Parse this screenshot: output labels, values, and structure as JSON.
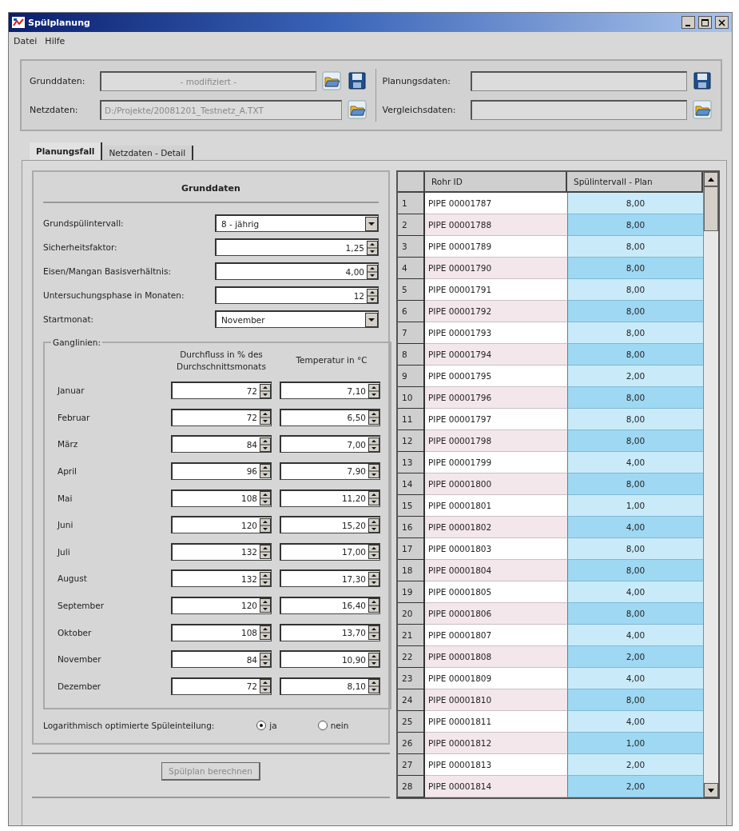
{
  "window": {
    "title": "Spülplanung"
  },
  "menu": [
    "Datei",
    "Hilfe"
  ],
  "files": {
    "left": [
      {
        "label": "Grunddaten:",
        "value": "- modifiziert -",
        "actions": [
          {
            "kind": "open"
          },
          {
            "kind": "save"
          }
        ]
      },
      {
        "label": "Netzdaten:",
        "value": "D:/Projekte/20081201_Testnetz_A.TXT",
        "actions": [
          {
            "kind": "open"
          }
        ]
      }
    ],
    "right": [
      {
        "label": "Planungsdaten:",
        "actions": [
          {
            "kind": "save"
          }
        ]
      },
      {
        "label": "Vergleichsdaten:",
        "actions": [
          {
            "kind": "open"
          }
        ]
      }
    ]
  },
  "tabs": [
    {
      "label": "Planungsfall",
      "selected": true
    },
    {
      "label": "Netzdaten - Detail",
      "selected": false
    }
  ],
  "grunddaten": {
    "title": "Grunddaten",
    "fields": [
      {
        "kind": "dropdown",
        "label": "Grundspülintervall:",
        "value": "8 - jährig"
      },
      {
        "kind": "spinner",
        "label": "Sicherheitsfaktor:",
        "value": "1,25"
      },
      {
        "kind": "spinner",
        "label": "Eisen/Mangan Basisverhältnis:",
        "value": "4,00"
      },
      {
        "kind": "spinner",
        "label": "Untersuchungsphase in Monaten:",
        "value": "12"
      },
      {
        "kind": "dropdown",
        "label": "Startmonat:",
        "value": "November"
      }
    ]
  },
  "ganglinien": {
    "title": "Ganglinien:",
    "columns": [
      "Durchfluss in % des Durchschnittsmonats",
      "Temperatur in °C"
    ],
    "rows": [
      {
        "month": "Januar",
        "flow": "72",
        "temp": "7,10"
      },
      {
        "month": "Februar",
        "flow": "72",
        "temp": "6,50"
      },
      {
        "month": "März",
        "flow": "84",
        "temp": "7,00"
      },
      {
        "month": "April",
        "flow": "96",
        "temp": "7,90"
      },
      {
        "month": "Mai",
        "flow": "108",
        "temp": "11,20"
      },
      {
        "month": "Juni",
        "flow": "120",
        "temp": "15,20"
      },
      {
        "month": "Juli",
        "flow": "132",
        "temp": "17,00"
      },
      {
        "month": "August",
        "flow": "132",
        "temp": "17,30"
      },
      {
        "month": "September",
        "flow": "120",
        "temp": "16,40"
      },
      {
        "month": "Oktober",
        "flow": "108",
        "temp": "13,70"
      },
      {
        "month": "November",
        "flow": "84",
        "temp": "10,90"
      },
      {
        "month": "Dezember",
        "flow": "72",
        "temp": "8,10"
      }
    ]
  },
  "log_option": {
    "label": "Logarithmisch optimierte Spüleinteilung:",
    "options": [
      {
        "label": "ja",
        "selected": true
      },
      {
        "label": "nein",
        "selected": false
      }
    ]
  },
  "calculate_button": {
    "label": "Spülplan berechnen",
    "disabled": true
  },
  "table": {
    "columns": [
      "Rohr ID",
      "Spülintervall - Plan"
    ],
    "rows": [
      {
        "number": "1",
        "id": "PIPE 00001787",
        "value": "8,00"
      },
      {
        "number": "2",
        "id": "PIPE 00001788",
        "value": "8,00"
      },
      {
        "number": "3",
        "id": "PIPE 00001789",
        "value": "8,00"
      },
      {
        "number": "4",
        "id": "PIPE 00001790",
        "value": "8,00"
      },
      {
        "number": "5",
        "id": "PIPE 00001791",
        "value": "8,00"
      },
      {
        "number": "6",
        "id": "PIPE 00001792",
        "value": "8,00"
      },
      {
        "number": "7",
        "id": "PIPE 00001793",
        "value": "8,00"
      },
      {
        "number": "8",
        "id": "PIPE 00001794",
        "value": "8,00"
      },
      {
        "number": "9",
        "id": "PIPE 00001795",
        "value": "2,00"
      },
      {
        "number": "10",
        "id": "PIPE 00001796",
        "value": "8,00"
      },
      {
        "number": "11",
        "id": "PIPE 00001797",
        "value": "8,00"
      },
      {
        "number": "12",
        "id": "PIPE 00001798",
        "value": "8,00"
      },
      {
        "number": "13",
        "id": "PIPE 00001799",
        "value": "4,00"
      },
      {
        "number": "14",
        "id": "PIPE 00001800",
        "value": "8,00"
      },
      {
        "number": "15",
        "id": "PIPE 00001801",
        "value": "1,00"
      },
      {
        "number": "16",
        "id": "PIPE 00001802",
        "value": "4,00"
      },
      {
        "number": "17",
        "id": "PIPE 00001803",
        "value": "8,00"
      },
      {
        "number": "18",
        "id": "PIPE 00001804",
        "value": "8,00"
      },
      {
        "number": "19",
        "id": "PIPE 00001805",
        "value": "4,00"
      },
      {
        "number": "20",
        "id": "PIPE 00001806",
        "value": "8,00"
      },
      {
        "number": "21",
        "id": "PIPE 00001807",
        "value": "4,00"
      },
      {
        "number": "22",
        "id": "PIPE 00001808",
        "value": "2,00"
      },
      {
        "number": "23",
        "id": "PIPE 00001809",
        "value": "4,00"
      },
      {
        "number": "24",
        "id": "PIPE 00001810",
        "value": "8,00"
      },
      {
        "number": "25",
        "id": "PIPE 00001811",
        "value": "4,00"
      },
      {
        "number": "26",
        "id": "PIPE 00001812",
        "value": "1,00"
      },
      {
        "number": "27",
        "id": "PIPE 00001813",
        "value": "2,00"
      },
      {
        "number": "28",
        "id": "PIPE 00001814",
        "value": "2,00"
      }
    ]
  }
}
